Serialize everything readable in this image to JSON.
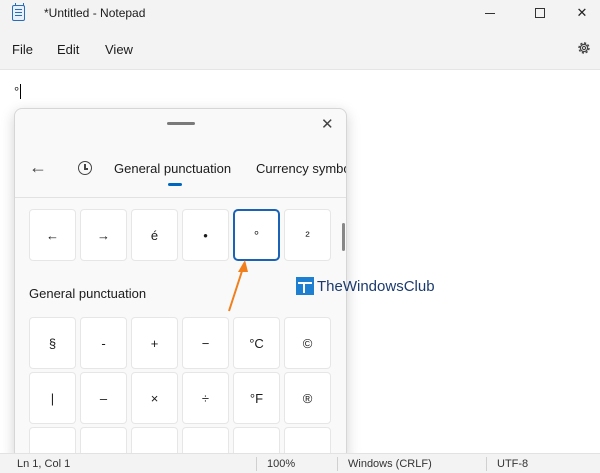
{
  "window": {
    "title": "*Untitled - Notepad",
    "icon": "notepad-icon",
    "controls": [
      "minimize-icon",
      "maximize-icon",
      "close-icon"
    ]
  },
  "menu": {
    "items": [
      "File",
      "Edit",
      "View"
    ],
    "settings_icon": "gear-icon"
  },
  "editor": {
    "content": "°"
  },
  "emoji_panel": {
    "tabs": {
      "general": "General punctuation",
      "currency": "Currency symbo"
    },
    "row1": [
      "←",
      "→",
      "é",
      "•",
      "°",
      "²"
    ],
    "selected_symbol": "°",
    "section_title": "General punctuation",
    "row2": [
      "§",
      "-",
      "+",
      "−",
      "°C",
      "©"
    ],
    "row3": [
      "|",
      "–",
      "×",
      "÷",
      "°F",
      "®"
    ]
  },
  "status": {
    "position": "Ln 1, Col 1",
    "zoom": "100%",
    "line_ending": "Windows (CRLF)",
    "encoding": "UTF-8"
  },
  "watermark": "TheWindowsClub",
  "colors": {
    "accent": "#0067c0",
    "annotation_arrow": "#f07f1c"
  }
}
